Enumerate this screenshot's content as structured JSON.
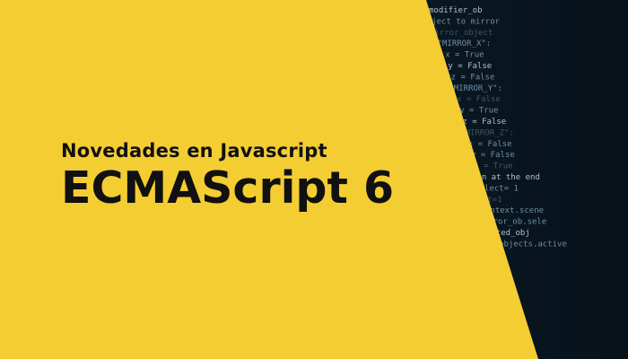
{
  "banner": {
    "subtitle": "Novedades en Javascript",
    "title": "ECMAScript 6"
  },
  "background_code": [
    "modifier_ob",
    "ject to mirror",
    "irror_object",
    "\"MIRROR_X\":",
    "_x = True",
    "_y = False",
    "_z = False",
    "\"MIRROR_Y\":",
    "_x = False",
    "_y = True",
    "_z = False",
    "\"MIRROR_Z\":",
    "_x = False",
    "_y = False",
    "_z = True",
    "ion at the end",
    "select= 1",
    "ect=1",
    "context.scene",
    "irror_ob.sele",
    "ected_obj",
    "o.objects.active"
  ],
  "colors": {
    "panel_yellow": "#f4cd33",
    "text_dark": "#111111",
    "code_bg_dark": "#0f1d28"
  }
}
